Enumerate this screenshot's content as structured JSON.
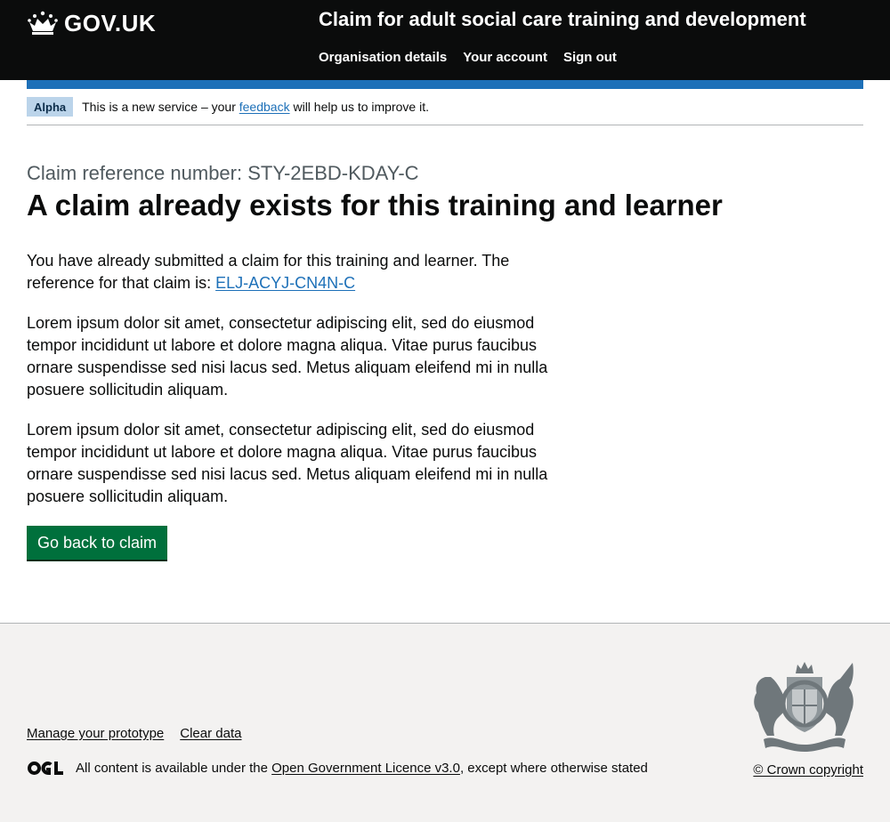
{
  "header": {
    "logo_text": "GOV.UK",
    "service_name": "Claim for adult social care training and development",
    "nav": [
      {
        "label": "Organisation details"
      },
      {
        "label": "Your account"
      },
      {
        "label": "Sign out"
      }
    ]
  },
  "phase_banner": {
    "tag": "Alpha",
    "text_before": "This is a new service – your ",
    "link": "feedback",
    "text_after": " will help us to improve it."
  },
  "main": {
    "caption": "Claim reference number: STY-2EBD-KDAY-C",
    "title": "A claim already exists for this training and learner",
    "para1_text": "You have already submitted a claim for this training and learner. The reference for that claim is: ",
    "para1_link": "ELJ-ACYJ-CN4N-C",
    "para2": "Lorem ipsum dolor sit amet, consectetur adipiscing elit, sed do eiusmod tempor incididunt ut labore et dolore magna aliqua. Vitae purus faucibus ornare suspendisse sed nisi lacus sed. Metus aliquam eleifend mi in nulla posuere sollicitudin aliquam.",
    "para3": "Lorem ipsum dolor sit amet, consectetur adipiscing elit, sed do eiusmod tempor incididunt ut labore et dolore magna aliqua. Vitae purus faucibus ornare suspendisse sed nisi lacus sed. Metus aliquam eleifend mi in nulla posuere sollicitudin aliquam.",
    "button_label": "Go back to claim"
  },
  "footer": {
    "links": [
      {
        "label": "Manage your prototype"
      },
      {
        "label": "Clear data"
      }
    ],
    "licence_before": "All content is available under the ",
    "licence_link": "Open Government Licence v3.0",
    "licence_after": ", except where otherwise stated",
    "copyright": "© Crown copyright"
  },
  "colors": {
    "header_bg": "#0b0c0c",
    "accent_blue": "#1d70b8",
    "button_green": "#00703c",
    "footer_bg": "#f3f2f1",
    "phase_tag_bg": "#bbd4ea"
  }
}
